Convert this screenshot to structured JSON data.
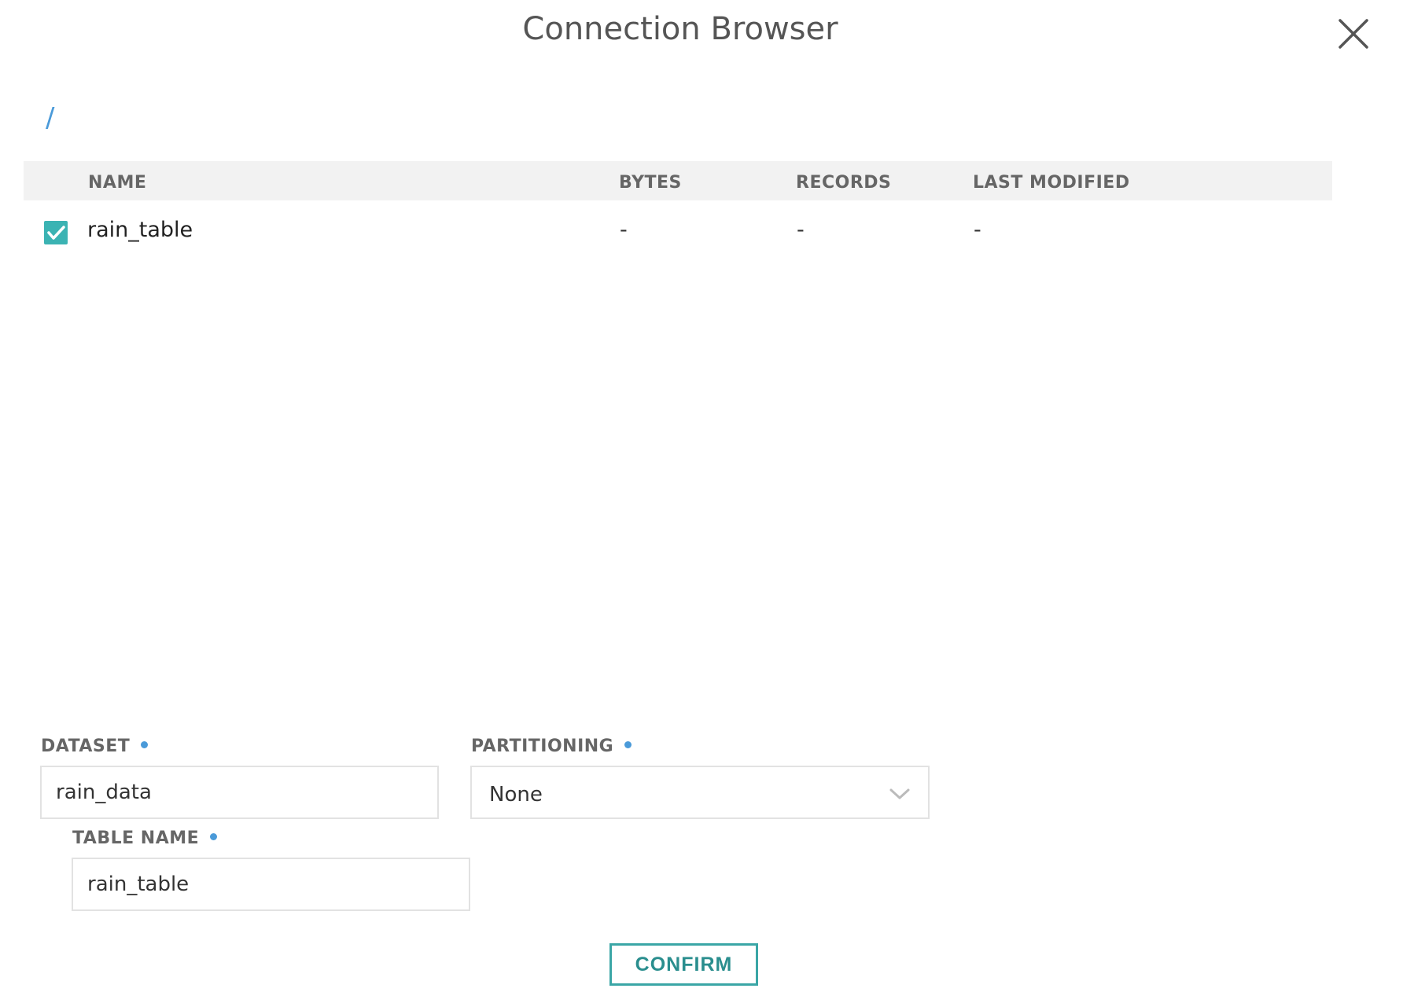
{
  "dialog": {
    "title": "Connection Browser"
  },
  "breadcrumb": {
    "path": "/"
  },
  "table": {
    "columns": [
      "NAME",
      "BYTES",
      "RECORDS",
      "LAST MODIFIED"
    ],
    "rows": [
      {
        "checked": true,
        "name": "rain_table",
        "bytes": "-",
        "records": "-",
        "last_modified": "-"
      }
    ]
  },
  "form": {
    "dataset": {
      "label": "DATASET",
      "value": "rain_data"
    },
    "partitioning": {
      "label": "PARTITIONING",
      "value": "None"
    },
    "table_name": {
      "label": "TABLE NAME",
      "value": "rain_table"
    }
  },
  "actions": {
    "confirm_label": "CONFIRM"
  },
  "icons": {
    "close": "close-icon",
    "checkbox": "checkmark-icon",
    "dropdown": "chevron-down-icon",
    "required": "required-dot"
  },
  "colors": {
    "accent_teal": "#3bb3b3",
    "link_blue": "#4a9ad9",
    "header_bg": "#f2f2f2"
  }
}
